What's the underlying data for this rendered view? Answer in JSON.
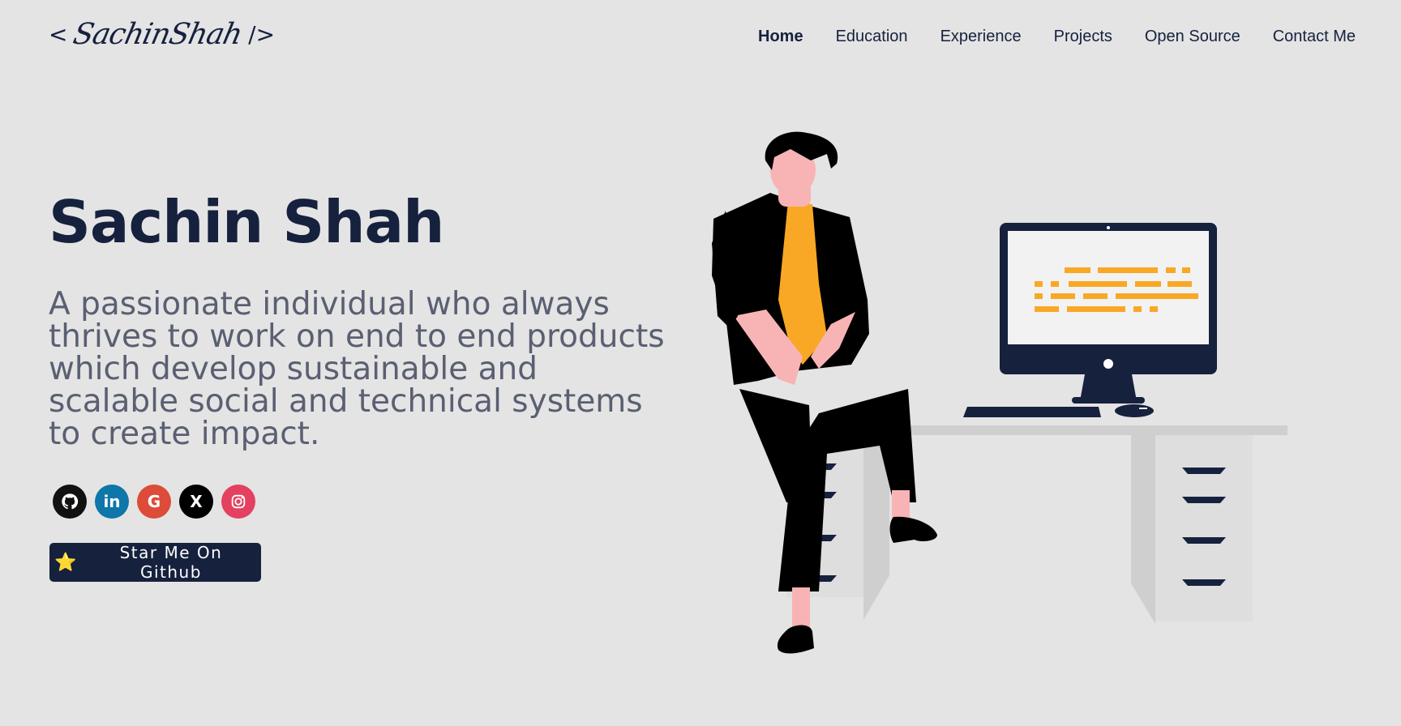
{
  "logo": {
    "open": "< ",
    "signature": "SachinShah",
    "close": " />"
  },
  "nav": {
    "items": [
      {
        "label": "Home",
        "active": true
      },
      {
        "label": "Education"
      },
      {
        "label": "Experience"
      },
      {
        "label": "Projects"
      },
      {
        "label": "Open Source"
      },
      {
        "label": "Contact Me"
      }
    ]
  },
  "hero": {
    "name": "Sachin Shah",
    "description": "A passionate individual who always thrives to work on end to end products which develop sustainable and scalable social and technical systems to create impact."
  },
  "socials": [
    {
      "icon": "github-icon",
      "glyph": "⌾"
    },
    {
      "icon": "linkedin-icon",
      "glyph": "in"
    },
    {
      "icon": "google-icon",
      "glyph": "G"
    },
    {
      "icon": "x-icon",
      "glyph": "X"
    },
    {
      "icon": "instagram-icon",
      "glyph": "◎"
    }
  ],
  "cta": {
    "icon": "⭐",
    "label": "Star Me On Github"
  },
  "colors": {
    "background": "#e4e4e4",
    "primary": "#16213e",
    "muted_text": "#5a5f72",
    "accent_yellow": "#f9a825",
    "skin": "#f8b4b4"
  }
}
